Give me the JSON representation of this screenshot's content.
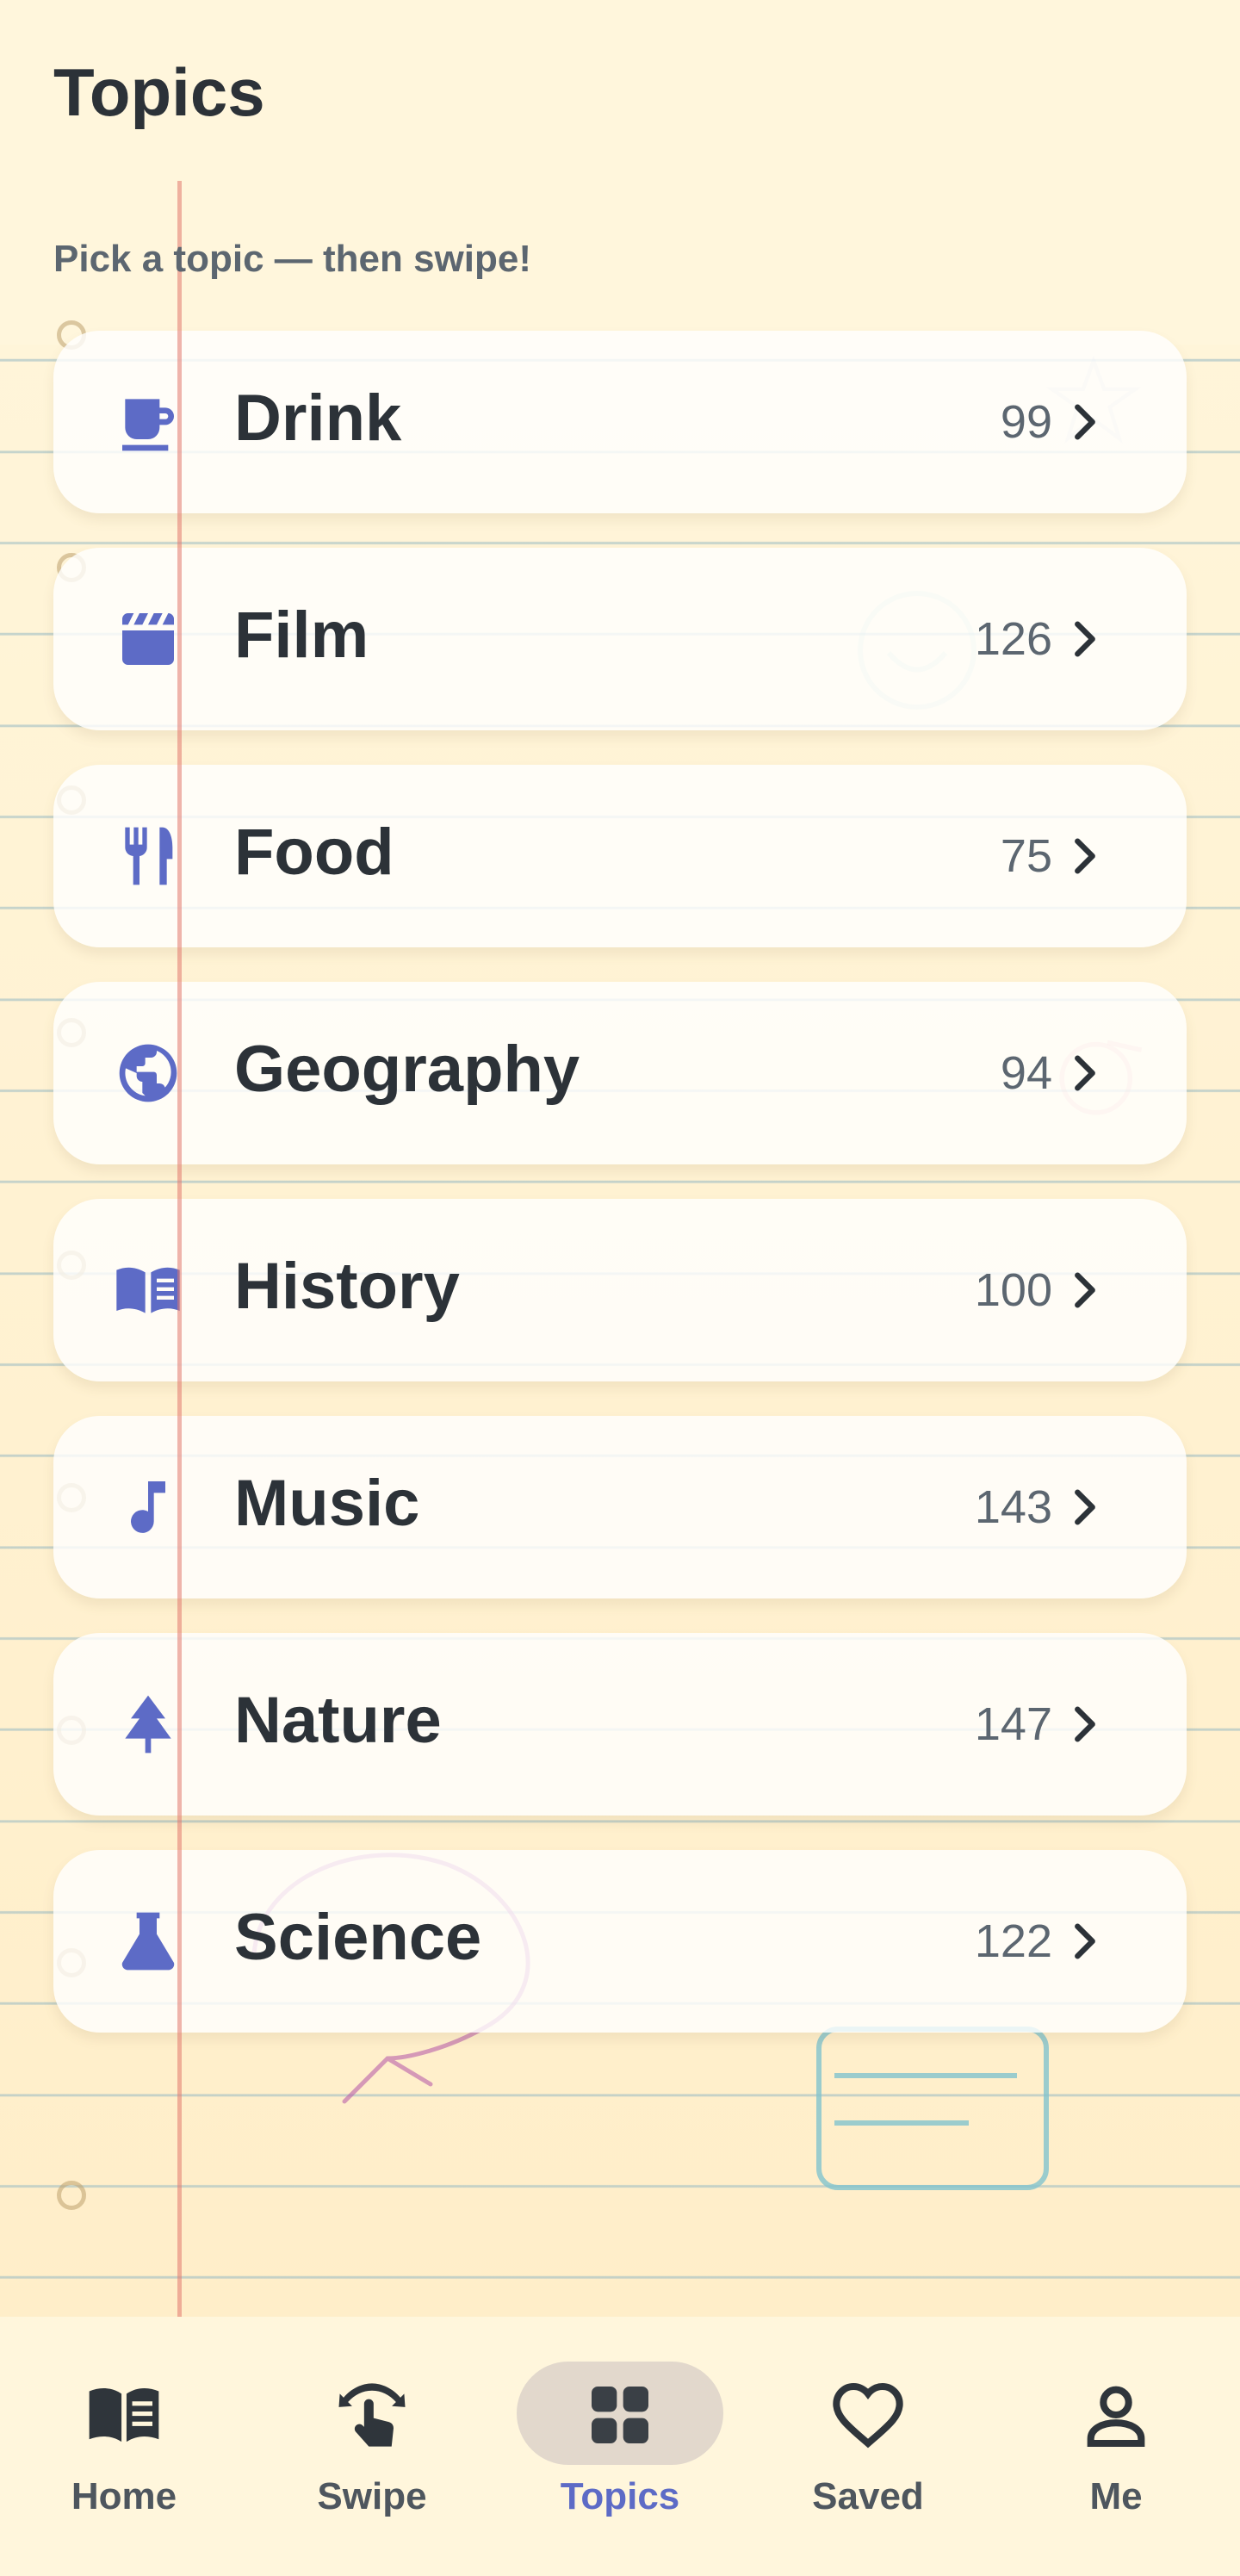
{
  "header": {
    "title": "Topics"
  },
  "subtitle": "Pick a topic — then swipe!",
  "topics": [
    {
      "label": "Drink",
      "count": "99",
      "icon": "cup-icon"
    },
    {
      "label": "Film",
      "count": "126",
      "icon": "clapperboard-icon"
    },
    {
      "label": "Food",
      "count": "75",
      "icon": "utensils-icon"
    },
    {
      "label": "Geography",
      "count": "94",
      "icon": "globe-icon"
    },
    {
      "label": "History",
      "count": "100",
      "icon": "open-book-icon"
    },
    {
      "label": "Music",
      "count": "143",
      "icon": "music-note-icon"
    },
    {
      "label": "Nature",
      "count": "147",
      "icon": "tree-icon"
    },
    {
      "label": "Science",
      "count": "122",
      "icon": "flask-icon"
    }
  ],
  "nav": {
    "items": [
      {
        "label": "Home",
        "icon": "book-icon",
        "active": false
      },
      {
        "label": "Swipe",
        "icon": "swipe-hand-icon",
        "active": false
      },
      {
        "label": "Topics",
        "icon": "grid-icon",
        "active": true
      },
      {
        "label": "Saved",
        "icon": "heart-icon",
        "active": false
      },
      {
        "label": "Me",
        "icon": "person-icon",
        "active": false
      }
    ]
  },
  "colors": {
    "accent": "#5d6bc6",
    "background": "#fff6dc",
    "margin_line": "#e2786e",
    "text": "#2c3238"
  }
}
